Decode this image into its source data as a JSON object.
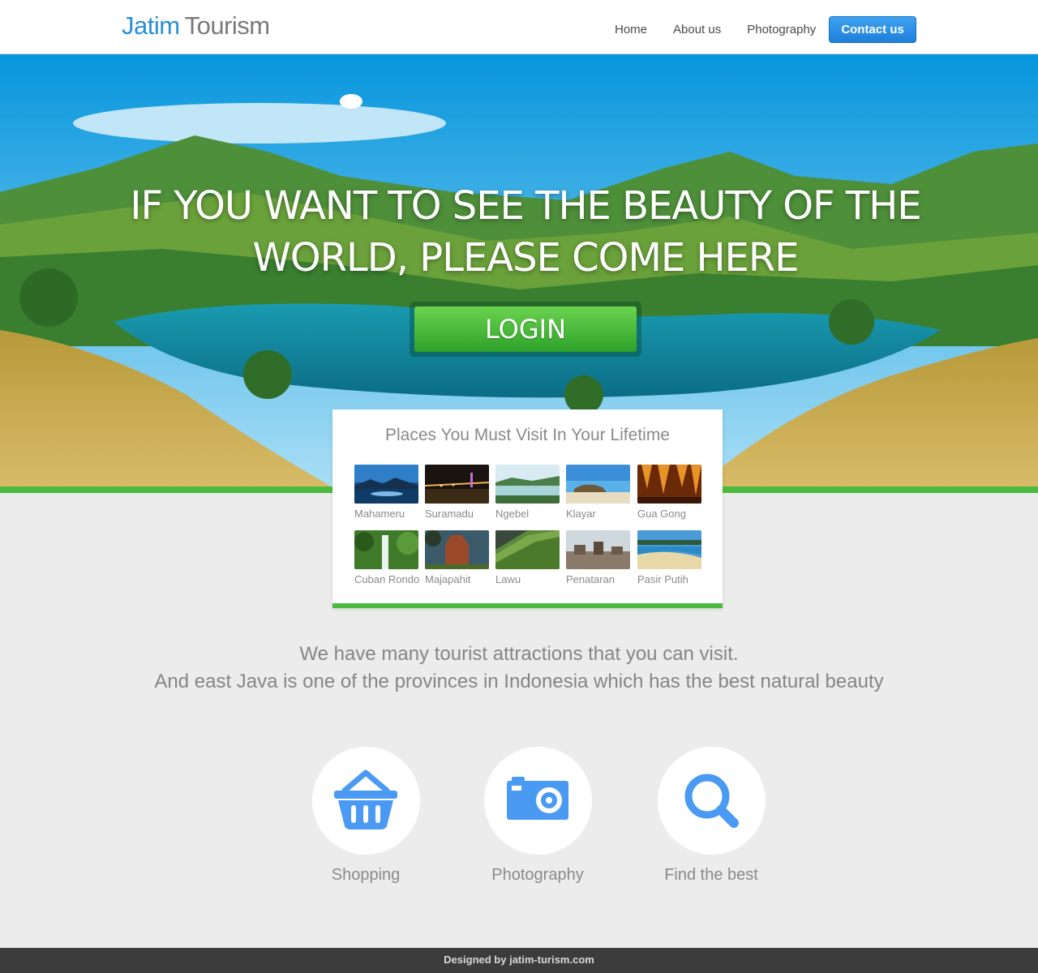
{
  "header": {
    "logo_primary": "Jatim",
    "logo_secondary": "Tourism",
    "nav": [
      "Home",
      "About us",
      "Photography"
    ],
    "cta": "Contact us"
  },
  "hero": {
    "headline": "IF YOU WANT TO SEE THE BEAUTY OF THE WORLD, PLEASE COME HERE",
    "login_label": "LOGIN"
  },
  "places": {
    "title": "Places You Must Visit In Your Lifetime",
    "items": [
      {
        "name": "Mahameru"
      },
      {
        "name": "Suramadu"
      },
      {
        "name": "Ngebel"
      },
      {
        "name": "Klayar"
      },
      {
        "name": "Gua Gong"
      },
      {
        "name": "Cuban Rondo"
      },
      {
        "name": "Majapahit"
      },
      {
        "name": "Lawu"
      },
      {
        "name": "Penataran"
      },
      {
        "name": "Pasir Putih"
      }
    ]
  },
  "intro": {
    "line1": "We have many tourist attractions that you can visit.",
    "line2": "And east Java is one of the provinces in Indonesia which has the best natural beauty"
  },
  "features": [
    {
      "label": "Shopping",
      "icon": "basket-icon"
    },
    {
      "label": "Photography",
      "icon": "camera-icon"
    },
    {
      "label": "Find the best",
      "icon": "search-icon"
    }
  ],
  "footer": {
    "credit": "Designed by jatim-turism.com"
  },
  "colors": {
    "brand_blue": "#2790d8",
    "accent_green": "#4cbb3d",
    "icon_blue": "#4a9af3"
  }
}
